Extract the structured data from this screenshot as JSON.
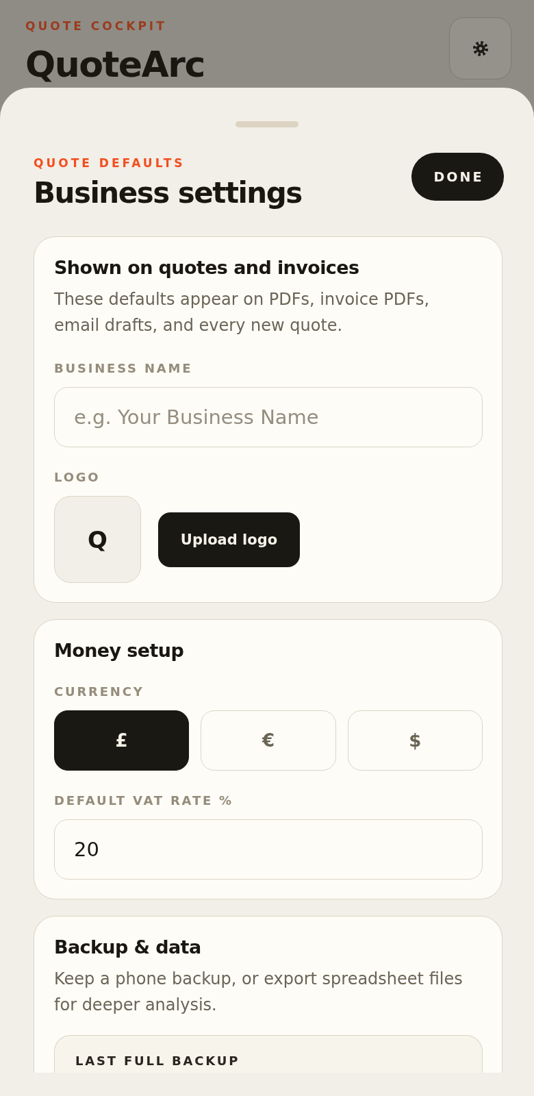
{
  "app_header": {
    "eyebrow": "QUOTE COCKPIT",
    "title": "QuoteArc"
  },
  "sheet": {
    "eyebrow": "QUOTE DEFAULTS",
    "title": "Business settings",
    "done_button": "DONE"
  },
  "sections": [
    {
      "title": "Shown on quotes and invoices",
      "description": "These defaults appear on PDFs, invoice PDFs, email drafts, and every new quote.",
      "fields": [
        {
          "kind": "text",
          "label": "BUSINESS NAME",
          "placeholder": "e.g. Your Business Name"
        },
        {
          "kind": "logo",
          "label": "LOGO",
          "preview": "Q",
          "button": "Upload logo"
        }
      ]
    },
    {
      "title": "Money setup",
      "fields": [
        {
          "kind": "choice",
          "label": "CURRENCY",
          "options": [
            {
              "label": "£",
              "selected": true
            },
            {
              "label": "€",
              "selected": false
            },
            {
              "label": "$",
              "selected": false
            }
          ]
        },
        {
          "kind": "text",
          "label": "DEFAULT VAT RATE %",
          "value": "20"
        }
      ]
    },
    {
      "title": "Backup & data",
      "description": "Keep a phone backup, or export spreadsheet files for deeper analysis.",
      "fields": [
        {
          "kind": "panel",
          "label": "LAST FULL BACKUP"
        }
      ]
    }
  ]
}
